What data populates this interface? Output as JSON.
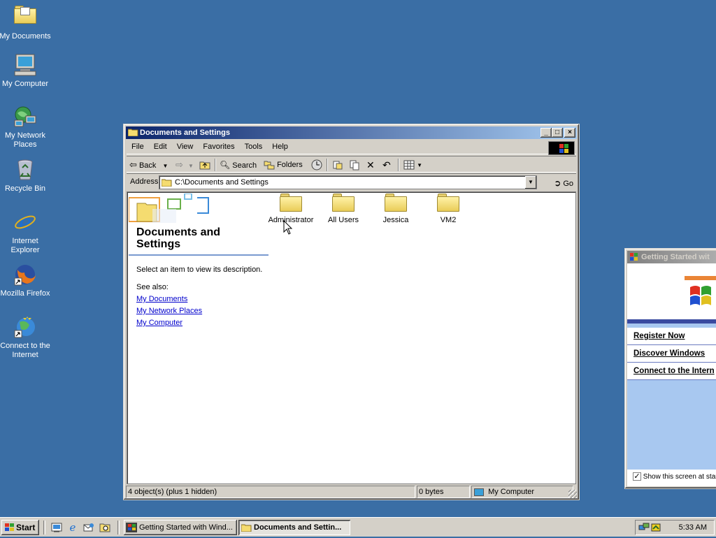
{
  "desktop": {
    "icons": [
      {
        "label": "My Documents"
      },
      {
        "label": "My Computer"
      },
      {
        "label": "My Network Places"
      },
      {
        "label": "Recycle Bin"
      },
      {
        "label": "Internet Explorer"
      },
      {
        "label": "Mozilla Firefox"
      },
      {
        "label": "Connect to the Internet"
      }
    ]
  },
  "explorer": {
    "title": "Documents and Settings",
    "menu": [
      "File",
      "Edit",
      "View",
      "Favorites",
      "Tools",
      "Help"
    ],
    "toolbar": {
      "back": "Back",
      "search": "Search",
      "folders": "Folders"
    },
    "address": {
      "label": "Address",
      "value": "C:\\Documents and Settings",
      "go": "Go"
    },
    "sidepanel": {
      "heading": "Documents and Settings",
      "description": "Select an item to view its description.",
      "see_also": "See also:",
      "links": [
        "My Documents",
        "My Network Places",
        "My Computer"
      ]
    },
    "items": [
      {
        "label": "Administrator"
      },
      {
        "label": "All Users"
      },
      {
        "label": "Jessica"
      },
      {
        "label": "VM2"
      }
    ],
    "status": {
      "objects": "4 object(s) (plus 1 hidden)",
      "size": "0 bytes",
      "location": "My Computer"
    }
  },
  "getting_started": {
    "title": "Getting Started wit",
    "links": [
      "Register Now",
      "Discover Windows",
      "Connect to the Intern"
    ],
    "checkbox_label": "Show this screen at startu",
    "checked": true
  },
  "taskbar": {
    "start": "Start",
    "tasks": [
      {
        "label": "Getting Started with Wind..."
      },
      {
        "label": "Documents and Settin..."
      }
    ],
    "clock": "5:33 AM"
  }
}
